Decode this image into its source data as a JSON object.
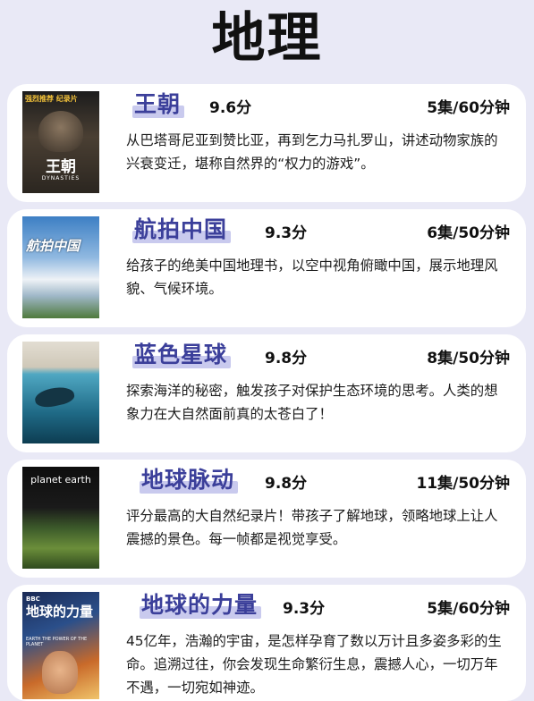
{
  "title": "地理",
  "cards": [
    {
      "name": "王朝",
      "score": "9.6分",
      "episodes": "5集/60分钟",
      "description": "从巴塔哥尼亚到赞比亚，再到乞力马扎罗山，讲述动物家族的兴衰变迁，堪称自然界的“权力的游戏”。",
      "poster": {
        "badge": "强烈推荐 纪录片",
        "title": "王朝",
        "subtitle": "DYNASTIES",
        "colors": [
          "#2a2a2a",
          "#6b5a46"
        ]
      }
    },
    {
      "name": "航拍中国",
      "score": "9.3分",
      "episodes": "6集/50分钟",
      "description": "给孩子的绝美中国地理书，以空中视角俯瞰中国，展示地理风貌、气候环境。",
      "poster": {
        "title": "航拍中国",
        "colors": [
          "#3d7fc4",
          "#e8eef5"
        ]
      }
    },
    {
      "name": "蓝色星球",
      "score": "9.8分",
      "episodes": "8集/50分钟",
      "description": "探索海洋的秘密，触发孩子对保护生态环境的思考。人类的想象力在大自然面前真的太苍白了！",
      "poster": {
        "colors": [
          "#d9d4c8",
          "#1f6a86"
        ]
      }
    },
    {
      "name": "地球脉动",
      "score": "9.8分",
      "episodes": "11集/50分钟",
      "description": "评分最高的大自然纪录片！带孩子了解地球，领略地球上让人震撼的景色。每一帧都是视觉享受。",
      "poster": {
        "title": "planet earth",
        "colors": [
          "#0e0e0e",
          "#4f7a2e"
        ]
      }
    },
    {
      "name": "地球的力量",
      "score": "9.3分",
      "episodes": "5集/60分钟",
      "description": "45亿年，浩瀚的宇宙，是怎样孕育了数以万计且多姿多彩的生命。追溯过往，你会发现生命繁衍生息，震撼人心，一切万年不遇，一切宛如神迹。",
      "poster": {
        "badge": "BBC",
        "title": "地球的力量",
        "subtitle": "EARTH THE POWER OF THE PLANET",
        "colors": [
          "#1a2a55",
          "#c96a2a"
        ]
      }
    }
  ]
}
